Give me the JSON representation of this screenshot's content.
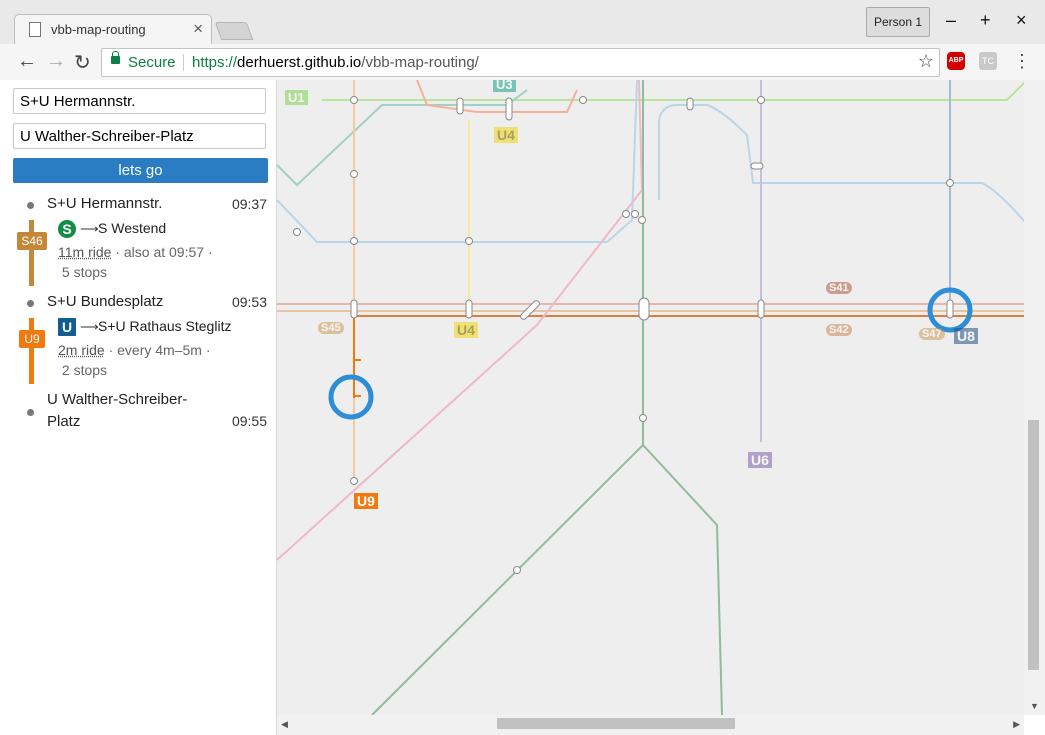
{
  "browser": {
    "tab_title": "vbb-map-routing",
    "tab_close": "×",
    "profile": "Person 1",
    "window_controls": {
      "minimize": "–",
      "maximize": "+",
      "close": "×"
    },
    "nav": {
      "back": "←",
      "forward": "→",
      "reload": "↻"
    },
    "secure_label": "Secure",
    "url_scheme": "https://",
    "url_host": "derhuerst.github.io",
    "url_path": "/vbb-map-routing/",
    "star": "☆",
    "ext_abp": "ABP",
    "ext_other": "TC",
    "menu": "⋮"
  },
  "search": {
    "from_value": "S+U Hermannstr.",
    "to_value": "U Walther-Schreiber-Platz",
    "submit_label": "lets go"
  },
  "journey": {
    "stops": [
      {
        "name": "S+U Hermannstr.",
        "time": "09:37"
      },
      {
        "name": "S+U Bundesplatz",
        "time": "09:53"
      },
      {
        "name": "U Walther-Schreiber-Platz",
        "time": "09:55"
      }
    ],
    "legs": [
      {
        "line": "S46",
        "color": "#c4883a",
        "mode_icon": "S",
        "mode_color": "#138c45",
        "arrow": "⟶",
        "direction": "S Westend",
        "ride": "11m ride",
        "frequency": "· also at 09:57 ·",
        "stops": "5 stops"
      },
      {
        "line": "U9",
        "color": "#f07a0e",
        "mode_icon": "U",
        "mode_color": "#115d91",
        "arrow": "⟶",
        "direction": "S+U Rathaus Steglitz",
        "ride": "2m ride",
        "frequency": "· every 4m–5m ·",
        "stops": "2 stops"
      }
    ]
  },
  "map": {
    "labels": [
      {
        "text": "U1",
        "bg": "#7dd34f",
        "fg": "#fff"
      },
      {
        "text": "U3",
        "bg": "#16a085",
        "fg": "#fff"
      },
      {
        "text": "U4",
        "bg": "#f0d722",
        "fg": "#806a00"
      },
      {
        "text": "S41",
        "bg": "#a63a1e",
        "fg": "#fff"
      },
      {
        "text": "S45",
        "bg": "#c48b3c",
        "fg": "#fff"
      },
      {
        "text": "U4",
        "bg": "#f0d722",
        "fg": "#806a00"
      },
      {
        "text": "S42",
        "bg": "#c8703a",
        "fg": "#fff"
      },
      {
        "text": "S47",
        "bg": "#c48b3c",
        "fg": "#fff"
      },
      {
        "text": "U8",
        "bg": "#224f86",
        "fg": "#fff"
      },
      {
        "text": "U6",
        "bg": "#7d64b1",
        "fg": "#fff"
      },
      {
        "text": "U9",
        "bg": "#f07a0e",
        "fg": "#fff"
      }
    ],
    "highlight_color": "#2d8ed6"
  },
  "scrollbars": {
    "left": "◀",
    "right": "▶",
    "down": "▼"
  }
}
